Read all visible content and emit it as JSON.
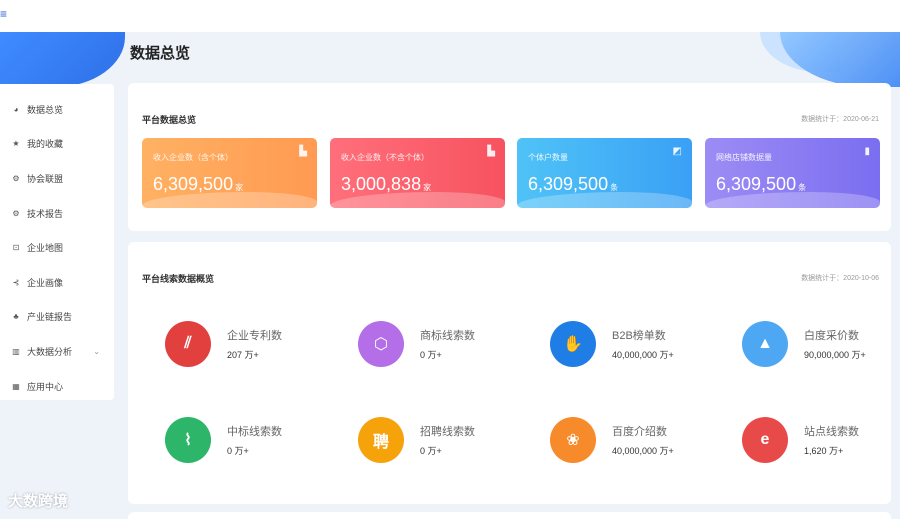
{
  "page": {
    "title": "数据总览",
    "logo_glyph": "≡"
  },
  "sidebar": {
    "items": [
      {
        "label": "数据总览",
        "icon": "pie-chart-icon",
        "glyph": "◕"
      },
      {
        "label": "我的收藏",
        "icon": "star-icon",
        "glyph": "★"
      },
      {
        "label": "协会联盟",
        "icon": "gear-icon",
        "glyph": "⚙"
      },
      {
        "label": "技术报告",
        "icon": "settings-icon",
        "glyph": "⚙"
      },
      {
        "label": "企业地图",
        "icon": "map-icon",
        "glyph": "⊡"
      },
      {
        "label": "企业画像",
        "icon": "send-icon",
        "glyph": "⊰"
      },
      {
        "label": "产业链报告",
        "icon": "org-chart-icon",
        "glyph": "♣"
      },
      {
        "label": "大数据分析",
        "icon": "bar-chart-icon",
        "glyph": "▥",
        "chevron": "⌄"
      },
      {
        "label": "应用中心",
        "icon": "grid-icon",
        "glyph": "▦"
      }
    ]
  },
  "overview": {
    "title": "平台数据总览",
    "date": "数据统计于：2020-06-21",
    "cards": [
      {
        "label": "收入企业数（含个体）",
        "value": "6,309,500",
        "unit": "家",
        "icon": "building-icon",
        "glyph": "▙",
        "color": "#ff9a52"
      },
      {
        "label": "收入企业数（不含个体）",
        "value": "3,000,838",
        "unit": "家",
        "icon": "building-icon",
        "glyph": "▙",
        "color": "#f7525f"
      },
      {
        "label": "个体户数量",
        "value": "6,309,500",
        "unit": "条",
        "icon": "image-icon",
        "glyph": "◩",
        "color": "#3aa0f5"
      },
      {
        "label": "网络店铺数据量",
        "value": "6,309,500",
        "unit": "条",
        "icon": "bar-chart-icon",
        "glyph": "▮",
        "color": "#7b6ef0"
      }
    ]
  },
  "lines": {
    "title": "平台线索数据概览",
    "date": "数据统计于：2020-10-06",
    "metrics": [
      {
        "label": "企业专利数",
        "value": "207 万+",
        "icon": "patent-icon",
        "glyph": "⫽",
        "color": "#e2403f"
      },
      {
        "label": "商标线索数",
        "value": "0 万+",
        "icon": "trademark-icon",
        "glyph": "⬡",
        "color": "#b36ee8"
      },
      {
        "label": "B2B榜单数",
        "value": "40,000,000 万+",
        "icon": "handshake-icon",
        "glyph": "✋",
        "color": "#1f7de6"
      },
      {
        "label": "白度采价数",
        "value": "90,000,000 万+",
        "icon": "trend-chart-icon",
        "glyph": "▲",
        "color": "#4da7f3"
      },
      {
        "label": "中标线索数",
        "value": "0 万+",
        "icon": "monitor-chart-icon",
        "glyph": "⌇",
        "color": "#2db56a"
      },
      {
        "label": "招聘线索数",
        "value": "0 万+",
        "icon": "recruit-icon",
        "glyph": "聘",
        "color": "#f5a20b"
      },
      {
        "label": "百度介绍数",
        "value": "40,000,000 万+",
        "icon": "paw-icon",
        "glyph": "❀",
        "color": "#f78a2a"
      },
      {
        "label": "站点线索数",
        "value": "1,620 万+",
        "icon": "browser-icon",
        "glyph": "e",
        "color": "#e84a4a"
      }
    ]
  },
  "watermark": {
    "text": "大数跨境"
  }
}
